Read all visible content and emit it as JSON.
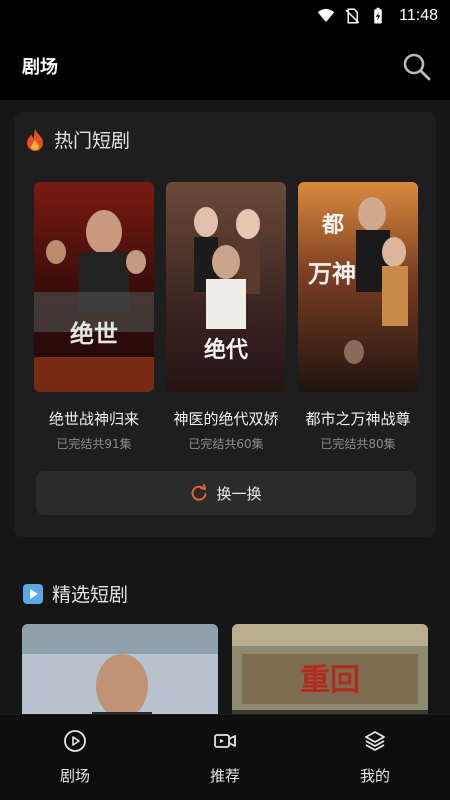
{
  "status_bar": {
    "time": "11:48"
  },
  "header": {
    "title": "剧场"
  },
  "hot_section": {
    "title": "热门短剧",
    "dramas": [
      {
        "title": "绝世战神归来",
        "status": "已完结共91集"
      },
      {
        "title": "神医的绝代双娇",
        "status": "已完结共60集"
      },
      {
        "title": "都市之万神战尊",
        "status": "已完结共80集"
      }
    ],
    "refresh_label": "换一换"
  },
  "featured_section": {
    "title": "精选短剧"
  },
  "tab_bar": {
    "tabs": [
      {
        "label": "剧场",
        "icon": "play-circle-icon"
      },
      {
        "label": "推荐",
        "icon": "video-camera-icon"
      },
      {
        "label": "我的",
        "icon": "layers-icon"
      }
    ]
  },
  "colors": {
    "accent": "#e0632b",
    "background": "#161616",
    "card": "#1e1e1e"
  }
}
